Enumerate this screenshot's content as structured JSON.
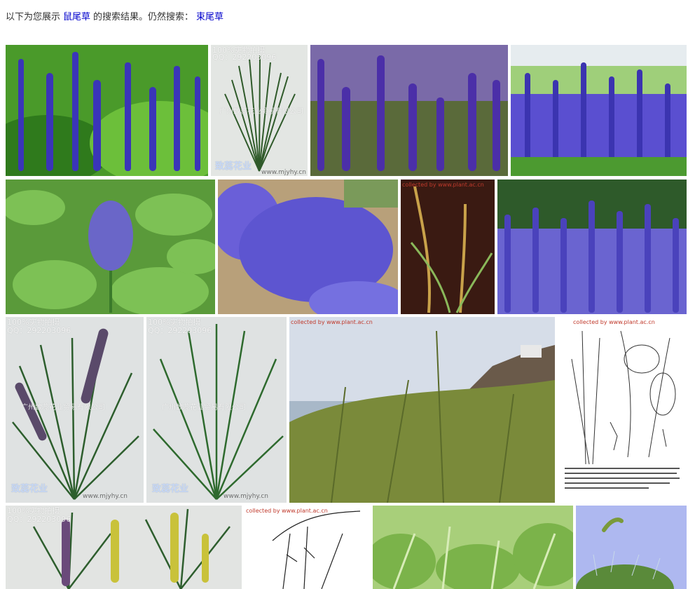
{
  "notice": {
    "prefix": "以下为您展示",
    "query": "鼠尾草",
    "middle": "的搜索结果。仍然搜索：",
    "alt_query": "束尾草"
  },
  "watermarks": {
    "shop_photo_label": "100%实物拍摄",
    "shop_qq": "QQ：292203096",
    "shop_company": "广州致蕊花业贸易有限公司",
    "shop_brand": "致蕊花业",
    "shop_site": "www.mjyhy.cn",
    "plant_site": "collected by www.plant.ac.cn"
  },
  "images": [
    {
      "id": 1,
      "subject": "blue-salvia"
    },
    {
      "id": 2,
      "subject": "artificial-grass-bunch"
    },
    {
      "id": 3,
      "subject": "purple-salvia-closeup"
    },
    {
      "id": 4,
      "subject": "salvia-field"
    },
    {
      "id": 5,
      "subject": "salvia-green-leaves"
    },
    {
      "id": 6,
      "subject": "salvia-bushes"
    },
    {
      "id": 7,
      "subject": "grass-on-dark"
    },
    {
      "id": 8,
      "subject": "salvia-before-hedge"
    },
    {
      "id": 9,
      "subject": "artificial-purple-grass"
    },
    {
      "id": 10,
      "subject": "artificial-green-grass"
    },
    {
      "id": 11,
      "subject": "coastal-grass"
    },
    {
      "id": 12,
      "subject": "botanical-drawing"
    },
    {
      "id": 13,
      "subject": "artificial-yellow-grass"
    },
    {
      "id": 14,
      "subject": "botanical-sketch"
    },
    {
      "id": 15,
      "subject": "green-grass-field"
    },
    {
      "id": 16,
      "subject": "foxtail-sky"
    }
  ]
}
